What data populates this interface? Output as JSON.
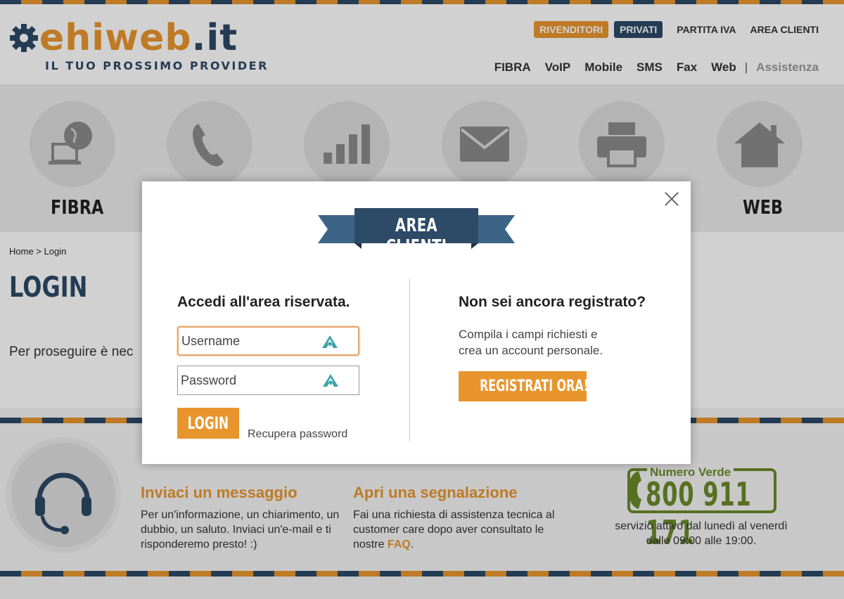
{
  "header": {
    "logo_main": "ehiweb",
    "logo_tld": ".it",
    "tagline": "IL TUO PROSSIMO PROVIDER",
    "top_links": {
      "rivenditori": "RIVENDITORI",
      "privati": "PRIVATI",
      "partita_iva": "PARTITA IVA",
      "area_clienti": "AREA CLIENTI"
    },
    "nav": [
      "FIBRA",
      "VoIP",
      "Mobile",
      "SMS",
      "Fax",
      "Web"
    ],
    "nav_separator": "|",
    "nav_assistenza": "Assistenza"
  },
  "band": {
    "labels": {
      "fibra": "FIBRA",
      "web": "WEB"
    },
    "icons": [
      "globe-laptop-icon",
      "phone-icon",
      "signal-bars-icon",
      "envelope-icon",
      "fax-icon",
      "house-icon"
    ]
  },
  "page": {
    "breadcrumb": "Home > Login",
    "title": "LOGIN",
    "text": "Per proseguire è nec"
  },
  "footer": {
    "message": {
      "title": "Inviaci un messaggio",
      "text": "Per un'informazione, un chiarimento, un dubbio, un saluto. Inviaci un'e-mail e ti risponderemo presto! :)"
    },
    "report": {
      "title": "Apri una segnalazione",
      "text_before": "Fai una richiesta di assistenza tecnica al customer care dopo aver consultato le nostre ",
      "faq": "FAQ",
      "text_after": "."
    },
    "numero_verde": {
      "label": "Numero Verde",
      "number": "800 911 171",
      "info_line1": "servizio attivo dal lunedì al venerdì",
      "info_line2": "dalle 09:00 alle 19:00."
    }
  },
  "modal": {
    "ribbon": "AREA CLIENTI",
    "login": {
      "title": "Accedi all'area riservata.",
      "username_placeholder": "Username",
      "password_placeholder": "Password",
      "button": "LOGIN",
      "recover": "Recupera password"
    },
    "register": {
      "title": "Non sei ancora registrato?",
      "text_line1": "Compila i campi richiesti e",
      "text_line2": "crea un account personale.",
      "button": "REGISTRATI ORA!"
    }
  },
  "colors": {
    "brand_orange": "#e8952e",
    "brand_navy": "#2d4a66",
    "numero_verde_green": "#6a8a2a"
  }
}
